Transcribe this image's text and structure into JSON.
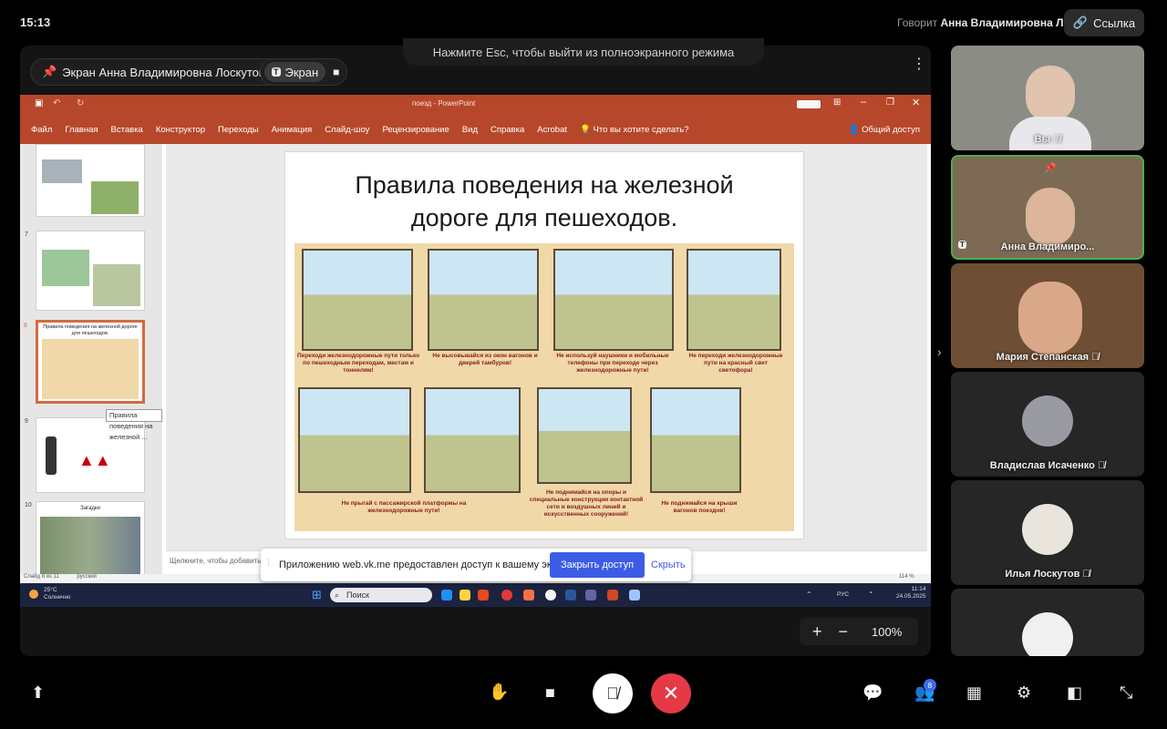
{
  "status": {
    "time": "15:13",
    "speaker_label": "Говорит",
    "speaker_name": "Анна Владимировна Л.",
    "link_label": "Ссылка"
  },
  "share": {
    "title": "Экран Анна Владимировна Лоскутова",
    "screen_label": "Экран",
    "esc_hint": "Нажмите Esc, чтобы выйти из полноэкранного режима"
  },
  "ppt": {
    "window_title": "поезд - PowerPoint",
    "tabs": [
      "Файл",
      "Главная",
      "Вставка",
      "Конструктор",
      "Переходы",
      "Анимация",
      "Слайд-шоу",
      "Рецензирование",
      "Вид",
      "Справка",
      "Acrobat",
      "Что вы хотите сделать?"
    ],
    "share_label": "Общий доступ",
    "thumbnails": [
      {
        "num": "7"
      },
      {
        "num": "8",
        "title": "Правила поведения на железной дороге для пешеходов."
      },
      {
        "num": "9"
      },
      {
        "num": "10",
        "title": "Загадки"
      }
    ],
    "tooltip": "Правила поведения на железной ...",
    "slide_title_1": "Правила поведения на железной",
    "slide_title_2": "дороге для пешеходов.",
    "captions": [
      "Переходи железнодорожные пути только по пешеходным переходам, местам и тоннелям!",
      "Не высовывайся из окон вагонов и дверей тамбуров!",
      "Не используй наушники и мобильные телефоны при переходе через железнодорожные пути!",
      "Не переходи железнодорожные пути на красный свет светофора!",
      "Не прыгай с пассажирской платформы на железнодорожные пути!",
      "Не поднимайся на опоры и специальные конструкции контактной сети и воздушных линий и искусственных сооружений!",
      "Не поднимайся на крыши вагонов поездов!"
    ],
    "notes_placeholder": "Щелкните, чтобы добавить з",
    "status_left": "Слайд 8 из 11",
    "status_lang": "русский",
    "zoom_pct": "114 %"
  },
  "taskbar": {
    "weather_temp": "25°C",
    "weather_text": "Солнечно",
    "search_placeholder": "Поиск",
    "lang": "РУС",
    "clock_time": "11:14",
    "clock_date": "24.05.2025"
  },
  "access_banner": {
    "message": "Приложению web.vk.me предоставлен доступ к вашему экрану.",
    "close_label": "Закрыть доступ",
    "hide_label": "Скрыть"
  },
  "zoom": {
    "plus": "+",
    "minus": "−",
    "level": "100%"
  },
  "participants": [
    {
      "name": "Вы"
    },
    {
      "name": "Анна Владимиро..."
    },
    {
      "name": "Мария Степанская"
    },
    {
      "name": "Владислав Исаченко"
    },
    {
      "name": "Илья Лоскутов"
    },
    {
      "name": ""
    }
  ],
  "controls": {
    "participants_badge": "8"
  },
  "colors": {
    "ppt_accent": "#b7472a",
    "active_tile": "#4caf50",
    "end_call": "#e63946",
    "primary_button": "#3d5ce6"
  }
}
